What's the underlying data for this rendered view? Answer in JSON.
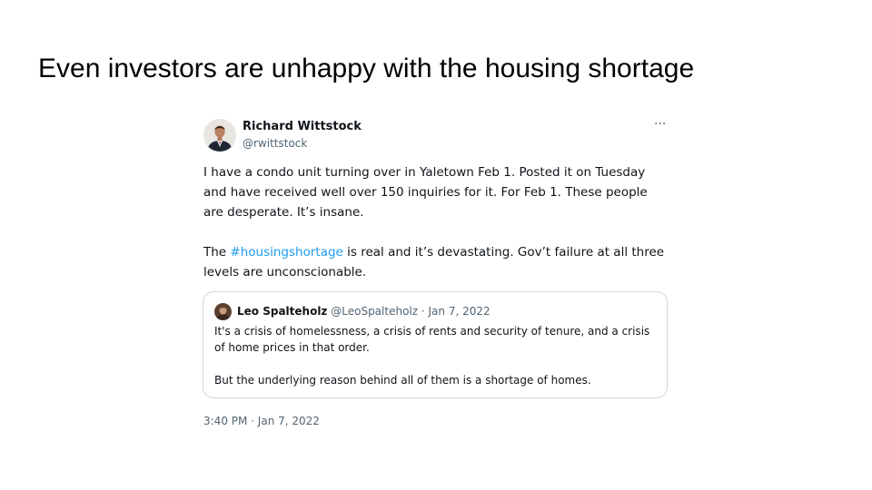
{
  "slide": {
    "title": "Even investors are unhappy with the housing shortage"
  },
  "tweet": {
    "author": {
      "name": "Richard Wittstock",
      "handle": "@rwittstock",
      "avatar_icon": "profile-photo"
    },
    "more_icon": "more-options-icon",
    "more_glyph": "···",
    "paragraph1": "I have a condo unit turning over in Yaletown Feb 1. Posted it on Tuesday and have received well over 150 inquiries for it. For Feb 1. These people are desperate. It’s insane.",
    "paragraph2_before": "The ",
    "paragraph2_hashtag": "#housingshortage",
    "paragraph2_after": " is real and it’s devastating. Gov’t failure at all three levels are unconscionable.",
    "hashtag_color": "#1d9bf0",
    "quoted": {
      "name": "Leo Spalteholz",
      "handle": "@LeoSpalteholz",
      "separator": " · ",
      "date": "Jan 7, 2022",
      "paragraph1": "It's a crisis of homelessness, a crisis of rents and security of tenure, and a crisis of home prices in that order.",
      "paragraph2": "But the underlying reason behind all of them is a shortage of homes."
    },
    "timestamp": "3:40 PM · Jan 7, 2022"
  }
}
